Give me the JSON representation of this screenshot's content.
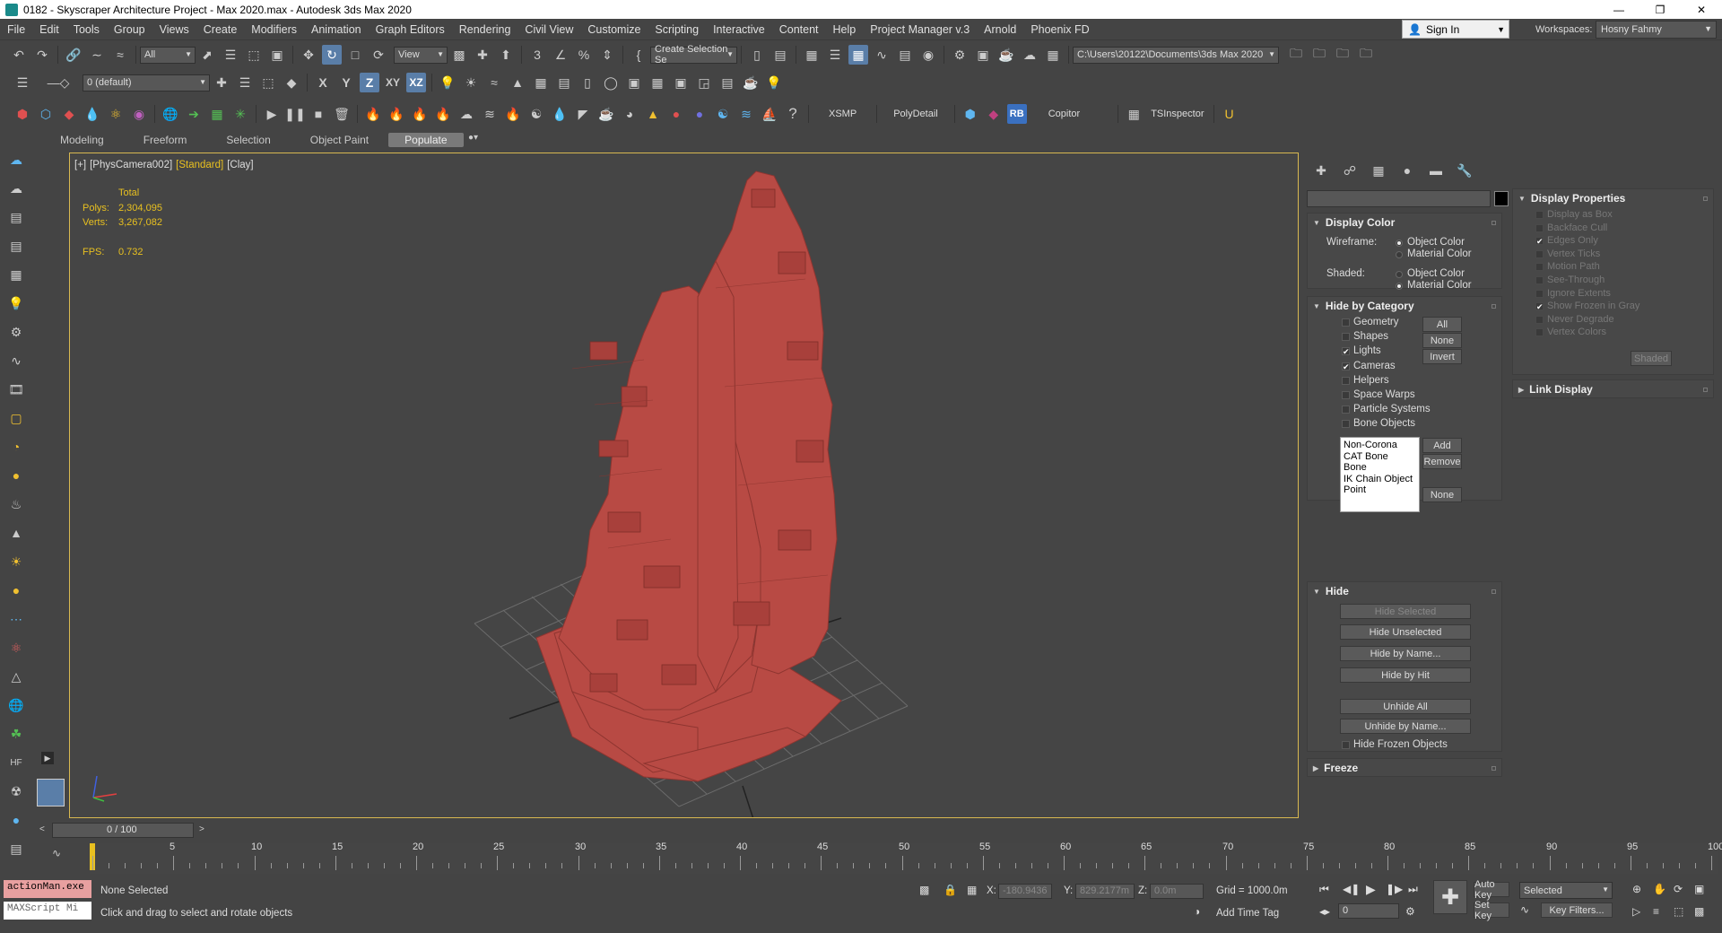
{
  "window": {
    "title": "0182 - Skyscraper Architecture Project - Max 2020.max - Autodesk 3ds Max 2020",
    "minimize": "—",
    "maximize": "❐",
    "close": "✕"
  },
  "menu": [
    "File",
    "Edit",
    "Tools",
    "Group",
    "Views",
    "Create",
    "Modifiers",
    "Animation",
    "Graph Editors",
    "Rendering",
    "Civil View",
    "Customize",
    "Scripting",
    "Interactive",
    "Content",
    "Help",
    "Project Manager v.3",
    "Arnold",
    "Phoenix FD"
  ],
  "account": {
    "signin": "Sign In",
    "workspaces_label": "Workspaces:",
    "workspace": "Hosny Fahmy"
  },
  "toolbar1": {
    "filter": "All",
    "ref_coord": "View",
    "selection_set": "Create Selection Se",
    "project_path": "C:\\Users\\20122\\Documents\\3ds Max 2020"
  },
  "toolbar2": {
    "layer": "0 (default)",
    "axis_x": "X",
    "axis_y": "Y",
    "axis_z": "Z",
    "axis_xy": "XY",
    "axis_xz": "XZ"
  },
  "toolbar3": {
    "xsmp": "XSMP",
    "polydetail": "PolyDetail",
    "rb": "RB",
    "copitor": "Copitor",
    "tsinspector": "TSInspector"
  },
  "ribbon": {
    "tabs": [
      "Modeling",
      "Freeform",
      "Selection",
      "Object Paint",
      "Populate"
    ],
    "active": "Populate"
  },
  "viewport": {
    "labels": [
      "[+]",
      "[PhysCamera002]",
      "[Standard]",
      "[Clay]"
    ],
    "stats": {
      "header": "Total",
      "polys_label": "Polys:",
      "polys": "2,304,095",
      "verts_label": "Verts:",
      "verts": "3,267,082",
      "fps_label": "FPS:",
      "fps": "0.732"
    },
    "model_color": "#b84a44"
  },
  "display_panel": {
    "display_color": {
      "title": "Display Color",
      "wireframe_label": "Wireframe:",
      "shaded_label": "Shaded:",
      "object_color": "Object Color",
      "material_color": "Material Color",
      "wireframe_selected": "Object Color",
      "shaded_selected": "Material Color"
    },
    "hide_by_category": {
      "title": "Hide by Category",
      "items": [
        {
          "label": "Geometry",
          "checked": false
        },
        {
          "label": "Shapes",
          "checked": false
        },
        {
          "label": "Lights",
          "checked": true
        },
        {
          "label": "Cameras",
          "checked": true
        },
        {
          "label": "Helpers",
          "checked": false
        },
        {
          "label": "Space Warps",
          "checked": false
        },
        {
          "label": "Particle Systems",
          "checked": false
        },
        {
          "label": "Bone Objects",
          "checked": false
        }
      ],
      "btn_all": "All",
      "btn_none": "None",
      "btn_invert": "Invert",
      "list": [
        "Non-Corona",
        "CAT Bone",
        "Bone",
        "IK Chain Object",
        "Point"
      ],
      "btn_add": "Add",
      "btn_remove": "Remove",
      "btn_none2": "None"
    },
    "hide": {
      "title": "Hide",
      "hide_selected": "Hide Selected",
      "hide_unselected": "Hide Unselected",
      "hide_by_name": "Hide by Name...",
      "hide_by_hit": "Hide by Hit",
      "unhide_all": "Unhide All",
      "unhide_by_name": "Unhide by Name...",
      "hide_frozen": "Hide Frozen Objects"
    },
    "freeze": {
      "title": "Freeze"
    },
    "display_properties": {
      "title": "Display Properties",
      "items": [
        {
          "label": "Display as Box",
          "checked": false
        },
        {
          "label": "Backface Cull",
          "checked": false
        },
        {
          "label": "Edges Only",
          "checked": true
        },
        {
          "label": "Vertex Ticks",
          "checked": false
        },
        {
          "label": "Motion Path",
          "checked": false
        },
        {
          "label": "See-Through",
          "checked": false
        },
        {
          "label": "Ignore Extents",
          "checked": false
        },
        {
          "label": "Show Frozen in Gray",
          "checked": true
        },
        {
          "label": "Never Degrade",
          "checked": false
        },
        {
          "label": "Vertex Colors",
          "checked": false
        }
      ],
      "shaded_btn": "Shaded"
    },
    "link_display": {
      "title": "Link Display"
    }
  },
  "timeline": {
    "frame": "0 / 100",
    "ticks": [
      5,
      10,
      15,
      20,
      25,
      30,
      35,
      40,
      45,
      50,
      55,
      60,
      65,
      70,
      75,
      80,
      85,
      90,
      95,
      100
    ],
    "max_frame": 100
  },
  "status": {
    "maxscript_line1": "actionMan.exe",
    "maxscript_line2": "MAXScript Mi",
    "selection": "None Selected",
    "prompt": "Click and drag to select and rotate objects",
    "x_label": "X:",
    "x": "-180.9436",
    "y_label": "Y:",
    "y": "829.2177m",
    "z_label": "Z:",
    "z": "0.0m",
    "grid": "Grid = 1000.0m",
    "add_time_tag": "Add Time Tag",
    "auto_key": "Auto Key",
    "set_key": "Set Key",
    "key_mode": "Selected",
    "key_filters": "Key Filters...",
    "current_frame": "0"
  }
}
